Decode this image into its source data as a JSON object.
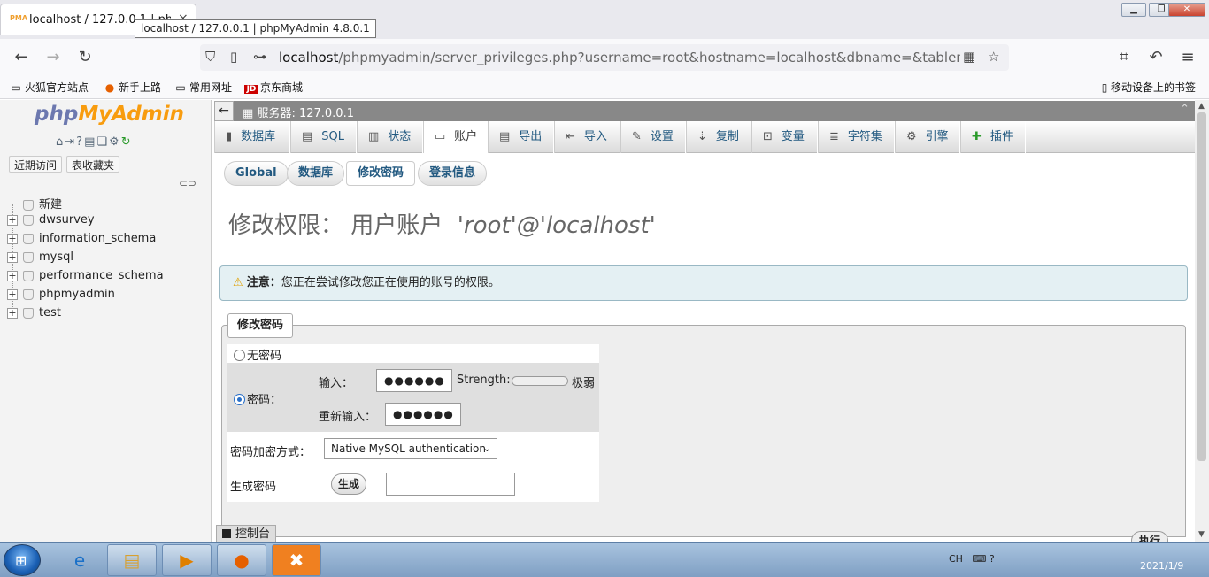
{
  "browser": {
    "tab_title": "localhost / 127.0.0.1 | phpMyAdmin 4.8.0.1",
    "tab_close": "×",
    "tooltip": "localhost / 127.0.0.1 | phpMyAdmin 4.8.0.1",
    "url_host": "localhost",
    "url_path": "/phpmyadmin/server_privileges.php?username=root&hostname=localhost&dbname=&tablename=&routinename=",
    "bookmarks": [
      "火狐官方站点",
      "新手上路",
      "常用网址",
      "京东商城"
    ],
    "mobile_bookmarks": "移动设备上的书签"
  },
  "left": {
    "logo_php": "php",
    "logo_myadmin": "MyAdmin",
    "btn_recent": "近期访问",
    "btn_favorites": "表收藏夹",
    "new_label": "新建",
    "databases": [
      "dwsurvey",
      "information_schema",
      "mysql",
      "performance_schema",
      "phpmyadmin",
      "test"
    ]
  },
  "server_bar": {
    "text": "服务器: 127.0.0.1"
  },
  "menu": [
    {
      "label": "数据库",
      "icon": "database-icon"
    },
    {
      "label": "SQL",
      "icon": "sql-icon"
    },
    {
      "label": "状态",
      "icon": "status-icon"
    },
    {
      "label": "账户",
      "icon": "users-icon"
    },
    {
      "label": "导出",
      "icon": "export-icon"
    },
    {
      "label": "导入",
      "icon": "import-icon"
    },
    {
      "label": "设置",
      "icon": "wrench-icon"
    },
    {
      "label": "复制",
      "icon": "replication-icon"
    },
    {
      "label": "变量",
      "icon": "variables-icon"
    },
    {
      "label": "字符集",
      "icon": "charset-icon"
    },
    {
      "label": "引擎",
      "icon": "engine-icon"
    },
    {
      "label": "插件",
      "icon": "plugin-icon"
    }
  ],
  "subtabs": [
    "Global",
    "数据库",
    "修改密码",
    "登录信息"
  ],
  "heading": {
    "prefix": "修改权限： 用户账户",
    "user": "'root'@'localhost'"
  },
  "notice": {
    "label": "注意：",
    "text": "您正在尝试修改您正在使用的账号的权限。"
  },
  "form": {
    "legend": "修改密码",
    "no_password": "无密码",
    "password_label": "密码：",
    "enter_label": "输入：",
    "enter_value": "●●●●●●",
    "strength_label": "Strength:",
    "strength_value": "极弱",
    "strength_level": 0,
    "reenter_label": "重新输入：",
    "reenter_value": "●●●●●●",
    "hash_label": "密码加密方式：",
    "hash_selected": "Native MySQL authentication",
    "generate_label": "生成密码",
    "generate_button": "生成",
    "generated_value": ""
  },
  "console": "控制台",
  "execute": "执行",
  "taskbar": {
    "tray_lang": "CH",
    "clock": "2021/1/9"
  }
}
